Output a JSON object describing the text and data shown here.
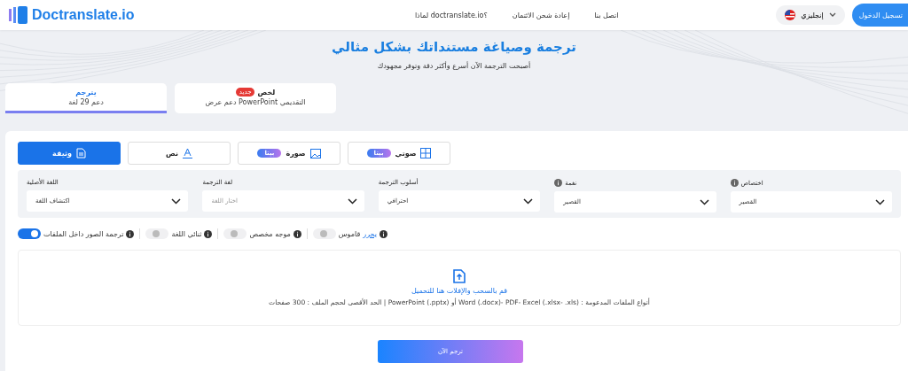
{
  "header": {
    "logo": "Doctranslate.io",
    "nav": [
      "اتصل بنا",
      "إعادة شحن الائتمان",
      "لماذا doctranslate.io؟"
    ],
    "language": "إنجليزي",
    "login": "تسجيل الدخول"
  },
  "hero": {
    "title": "ترجمة وصياغة مستنداتك بشكل مثالي",
    "subtitle": "أصبحت الترجمة الآن أسرع وأكثر دقة وتوفر مجهودك"
  },
  "tabs": [
    {
      "label": "لخص",
      "badge": "جديد",
      "sub": "دعم عرض PowerPoint التقديمي",
      "selected": false
    },
    {
      "label": "يترجم",
      "sub": "دعم 29 لغة",
      "selected": true
    }
  ],
  "types": [
    {
      "label": "صوتي",
      "kind": "audio",
      "badge": "بيتا",
      "selected": false
    },
    {
      "label": "صورة",
      "kind": "image",
      "badge": "بيتا",
      "selected": false
    },
    {
      "label": "نص",
      "kind": "text",
      "selected": false
    },
    {
      "label": "وثيقة",
      "kind": "document",
      "selected": true
    }
  ],
  "dropdowns": [
    {
      "label": "اختصاص",
      "value": "القصير",
      "info": true
    },
    {
      "label": "نغمة",
      "value": "القصير",
      "info": true
    },
    {
      "label": "أسلوب الترجمة",
      "value": "احترافي"
    },
    {
      "label": "لغة الترجمة",
      "placeholder": "اختار اللغة"
    },
    {
      "label": "اللغة الأصلية",
      "value": "اكتشاف اللغة"
    }
  ],
  "toggles": [
    {
      "label": "قاموس",
      "link": "يحرر",
      "on": false
    },
    {
      "label": "موجه مخصص",
      "on": false
    },
    {
      "label": "ثنائي اللغة",
      "on": false
    },
    {
      "label": "ترجمة الصور داخل الملفات",
      "on": true
    }
  ],
  "upload": {
    "prompt": "قم بالسحب والإفلات هنا للتحميل",
    "note": "الحد الأقصى لحجم الملف : 300 صفحات | PowerPoint (.pptx) أو Word (.docx)- PDF- Excel (.xlsx- .xls) : أنواع الملفات المدعومة"
  },
  "submit": "ترجم الآن"
}
